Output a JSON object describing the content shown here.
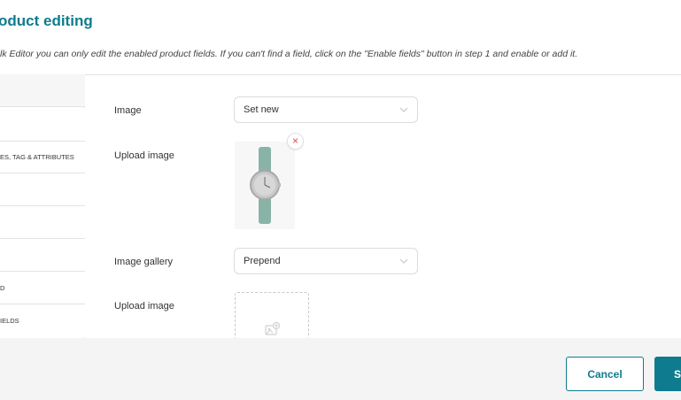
{
  "header": {
    "title": "oduct editing",
    "notice": "lk Editor you can only edit the enabled product fields. If you can't find a field, click on the \"Enable fields\" button in step 1 and enable or add it."
  },
  "sidebar": {
    "items": [
      {
        "label": ""
      },
      {
        "label": ""
      },
      {
        "label": "ES, TAG & ATTRIBUTES"
      },
      {
        "label": ""
      },
      {
        "label": ""
      },
      {
        "label": ""
      },
      {
        "label": "D"
      },
      {
        "label": "IELDS"
      }
    ]
  },
  "form": {
    "image": {
      "label": "Image",
      "value": "Set new"
    },
    "upload_image_1": {
      "label": "Upload image",
      "thumbnail": "watch-product-image"
    },
    "image_gallery": {
      "label": "Image gallery",
      "value": "Prepend"
    },
    "upload_image_2": {
      "label": "Upload image"
    }
  },
  "footer": {
    "cancel_label": "Cancel",
    "save_label": "S"
  },
  "colors": {
    "accent": "#0e7c8e",
    "remove": "#e74c3c",
    "watch_strap": "#8ab3a8",
    "footer_bg": "#f4f4f4"
  }
}
